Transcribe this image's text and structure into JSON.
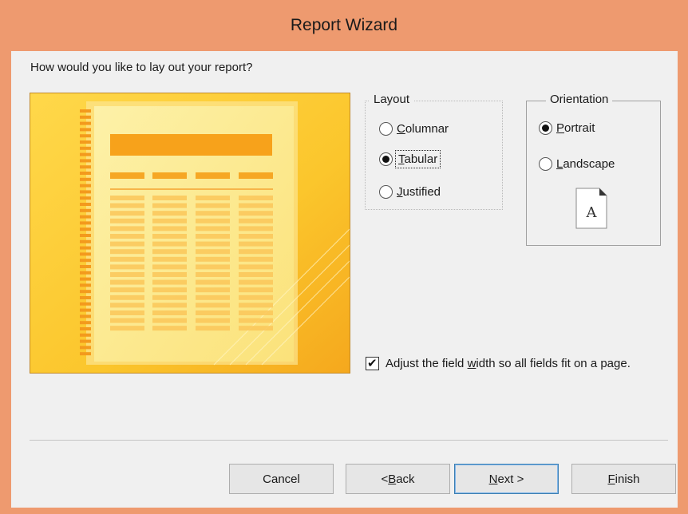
{
  "window": {
    "title": "Report Wizard"
  },
  "prompt": "How would you like to lay out your report?",
  "layout": {
    "legend": "Layout",
    "options": [
      {
        "prefix": "",
        "mnemonic": "C",
        "rest": "olumnar",
        "checked": false
      },
      {
        "prefix": "",
        "mnemonic": "T",
        "rest": "abular",
        "checked": true
      },
      {
        "prefix": "",
        "mnemonic": "J",
        "rest": "ustified",
        "checked": false
      }
    ]
  },
  "orientation": {
    "legend": "Orientation",
    "options": [
      {
        "prefix": "",
        "mnemonic": "P",
        "rest": "ortrait",
        "checked": true
      },
      {
        "prefix": "",
        "mnemonic": "L",
        "rest": "andscape",
        "checked": false
      }
    ],
    "page_icon_letter": "A"
  },
  "adjust_width": {
    "checked": true,
    "label_before": "Adjust the field ",
    "label_mnemonic": "w",
    "label_after": "idth so all fields fit on a page."
  },
  "buttons": {
    "cancel": {
      "prefix": "Cancel",
      "mnemonic": "",
      "rest": ""
    },
    "back": {
      "prefix": "< ",
      "mnemonic": "B",
      "rest": "ack"
    },
    "next": {
      "prefix": "",
      "mnemonic": "N",
      "rest": "ext >"
    },
    "finish": {
      "prefix": "",
      "mnemonic": "F",
      "rest": "inish"
    }
  },
  "colors": {
    "title_bar": "#ee9a6f",
    "dialog_bg": "#f0f0f0",
    "preview_yellow": "#fbd03a",
    "preview_bars": "#f7a21b"
  }
}
